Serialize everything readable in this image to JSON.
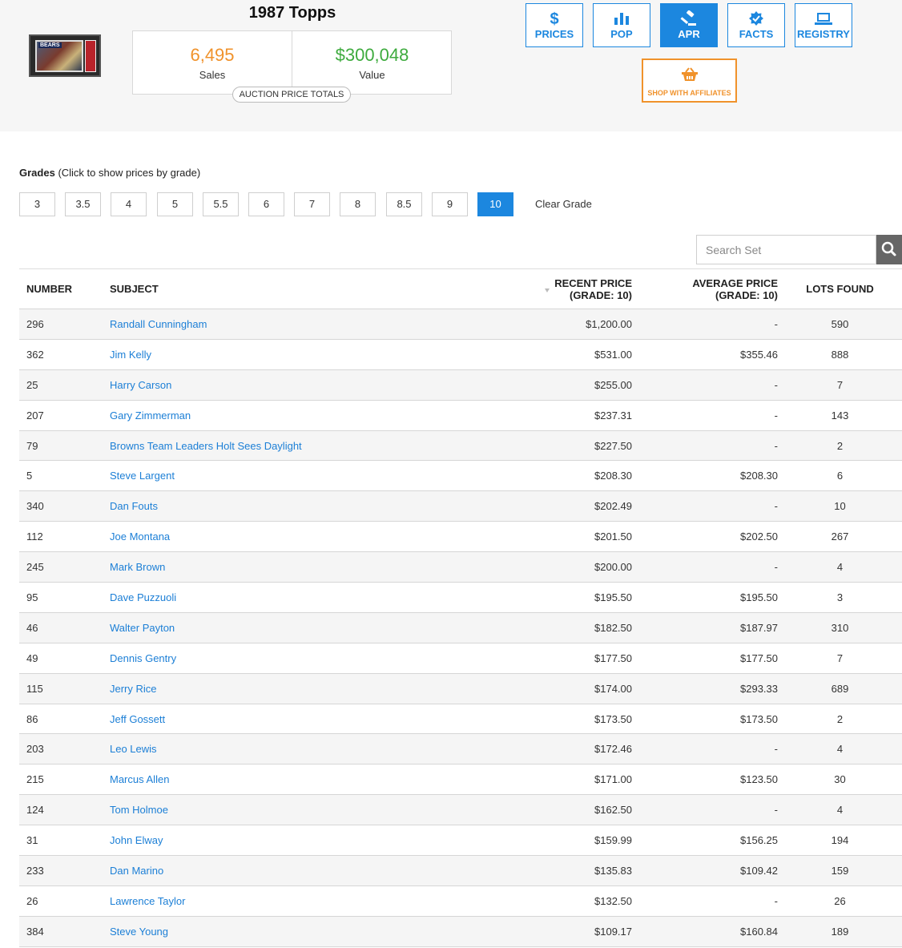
{
  "set_title": "1987 Topps",
  "thumbnail": {
    "card_label": "BEARS"
  },
  "totals": {
    "sales_value": "6,495",
    "sales_label": "Sales",
    "value_value": "$300,048",
    "value_label": "Value",
    "caption": "AUCTION PRICE TOTALS",
    "sales_color": "#f0922b",
    "value_color": "#3eab3e"
  },
  "nav": [
    {
      "label": "PRICES",
      "icon": "dollar-icon",
      "active": false
    },
    {
      "label": "POP",
      "icon": "bar-chart-icon",
      "active": false
    },
    {
      "label": "APR",
      "icon": "gavel-icon",
      "active": true
    },
    {
      "label": "FACTS",
      "icon": "badge-icon",
      "active": false
    },
    {
      "label": "REGISTRY",
      "icon": "laptop-icon",
      "active": false
    }
  ],
  "shop": {
    "label": "SHOP WITH AFFILIATES",
    "icon": "basket-icon"
  },
  "accent_color": "#1c87df",
  "grades": {
    "title_bold": "Grades",
    "title_hint": "(Click to show prices by grade)",
    "options": [
      "3",
      "3.5",
      "4",
      "5",
      "5.5",
      "6",
      "7",
      "8",
      "8.5",
      "9",
      "10"
    ],
    "selected": "10",
    "clear_label": "Clear Grade"
  },
  "search": {
    "placeholder": "Search Set",
    "icon": "search-icon"
  },
  "table": {
    "headers": {
      "number": "NUMBER",
      "subject": "SUBJECT",
      "recent_price_1": "RECENT PRICE",
      "recent_price_2": "(GRADE: 10)",
      "average_price_1": "AVERAGE PRICE",
      "average_price_2": "(GRADE: 10)",
      "lots_found": "LOTS FOUND"
    },
    "rows": [
      {
        "number": "296",
        "subject": "Randall Cunningham",
        "recent": "$1,200.00",
        "average": "-",
        "lots": "590"
      },
      {
        "number": "362",
        "subject": "Jim Kelly",
        "recent": "$531.00",
        "average": "$355.46",
        "lots": "888"
      },
      {
        "number": "25",
        "subject": "Harry Carson",
        "recent": "$255.00",
        "average": "-",
        "lots": "7"
      },
      {
        "number": "207",
        "subject": "Gary Zimmerman",
        "recent": "$237.31",
        "average": "-",
        "lots": "143"
      },
      {
        "number": "79",
        "subject": "Browns Team Leaders Holt Sees Daylight",
        "recent": "$227.50",
        "average": "-",
        "lots": "2"
      },
      {
        "number": "5",
        "subject": "Steve Largent",
        "recent": "$208.30",
        "average": "$208.30",
        "lots": "6"
      },
      {
        "number": "340",
        "subject": "Dan Fouts",
        "recent": "$202.49",
        "average": "-",
        "lots": "10"
      },
      {
        "number": "112",
        "subject": "Joe Montana",
        "recent": "$201.50",
        "average": "$202.50",
        "lots": "267"
      },
      {
        "number": "245",
        "subject": "Mark Brown",
        "recent": "$200.00",
        "average": "-",
        "lots": "4"
      },
      {
        "number": "95",
        "subject": "Dave Puzzuoli",
        "recent": "$195.50",
        "average": "$195.50",
        "lots": "3"
      },
      {
        "number": "46",
        "subject": "Walter Payton",
        "recent": "$182.50",
        "average": "$187.97",
        "lots": "310"
      },
      {
        "number": "49",
        "subject": "Dennis Gentry",
        "recent": "$177.50",
        "average": "$177.50",
        "lots": "7"
      },
      {
        "number": "115",
        "subject": "Jerry Rice",
        "recent": "$174.00",
        "average": "$293.33",
        "lots": "689"
      },
      {
        "number": "86",
        "subject": "Jeff Gossett",
        "recent": "$173.50",
        "average": "$173.50",
        "lots": "2"
      },
      {
        "number": "203",
        "subject": "Leo Lewis",
        "recent": "$172.46",
        "average": "-",
        "lots": "4"
      },
      {
        "number": "215",
        "subject": "Marcus Allen",
        "recent": "$171.00",
        "average": "$123.50",
        "lots": "30"
      },
      {
        "number": "124",
        "subject": "Tom Holmoe",
        "recent": "$162.50",
        "average": "-",
        "lots": "4"
      },
      {
        "number": "31",
        "subject": "John Elway",
        "recent": "$159.99",
        "average": "$156.25",
        "lots": "194"
      },
      {
        "number": "233",
        "subject": "Dan Marino",
        "recent": "$135.83",
        "average": "$109.42",
        "lots": "159"
      },
      {
        "number": "26",
        "subject": "Lawrence Taylor",
        "recent": "$132.50",
        "average": "-",
        "lots": "26"
      },
      {
        "number": "384",
        "subject": "Steve Young",
        "recent": "$109.17",
        "average": "$160.84",
        "lots": "189"
      }
    ]
  }
}
